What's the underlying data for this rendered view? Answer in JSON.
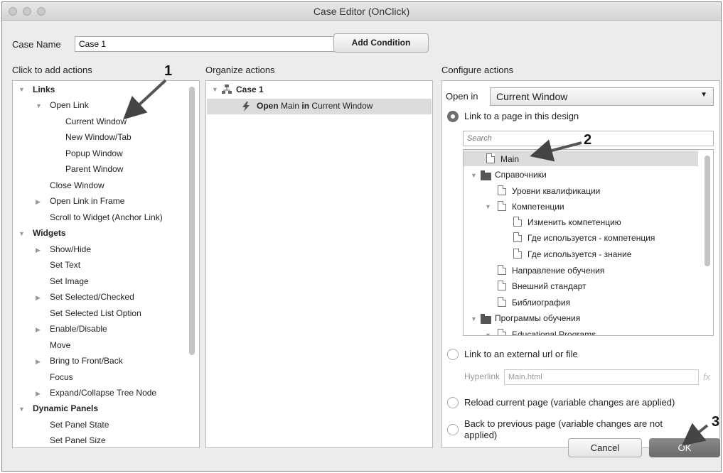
{
  "window": {
    "title": "Case Editor (OnClick)"
  },
  "case": {
    "name_label": "Case Name",
    "name_value": "Case 1",
    "add_condition": "Add Condition"
  },
  "sections": {
    "add": "Click to add actions",
    "organize": "Organize actions",
    "configure": "Configure actions"
  },
  "actions": [
    "Links",
    "Open Link",
    "Current Window",
    "New Window/Tab",
    "Popup Window",
    "Parent Window",
    "Close Window",
    "Open Link in Frame",
    "Scroll to Widget (Anchor Link)",
    "Widgets",
    "Show/Hide",
    "Set Text",
    "Set Image",
    "Set Selected/Checked",
    "Set Selected List Option",
    "Enable/Disable",
    "Move",
    "Bring to Front/Back",
    "Focus",
    "Expand/Collapse Tree Node",
    "Dynamic Panels",
    "Set Panel State",
    "Set Panel Size"
  ],
  "organize": {
    "case_label": "Case 1",
    "action_prefix": "Open",
    "action_target": "Main",
    "action_middle": "in",
    "action_suffix": "Current Window"
  },
  "configure": {
    "open_in_label": "Open in",
    "open_in_value": "Current Window",
    "option_page": "Link to a page in this design",
    "search_placeholder": "Search",
    "pages": [
      "Main",
      "Справочники",
      "Уровни квалификации",
      "Компетенции",
      "Изменить компетенцию",
      "Где используется - компетенция",
      "Где используется - знание",
      "Направление обучения",
      "Внешний стандарт",
      "Библиография",
      "Программы обучения",
      "Educational Programs"
    ],
    "option_url": "Link to an external url or file",
    "hyperlink_label": "Hyperlink",
    "hyperlink_value": "Main.html",
    "fx": "fx",
    "option_reload": "Reload current page (variable changes are applied)",
    "option_back_line1": "Back to previous page (variable changes are not",
    "option_back_line2": "applied)"
  },
  "buttons": {
    "cancel": "Cancel",
    "ok": "OK"
  },
  "callouts": [
    "1",
    "2",
    "3"
  ]
}
